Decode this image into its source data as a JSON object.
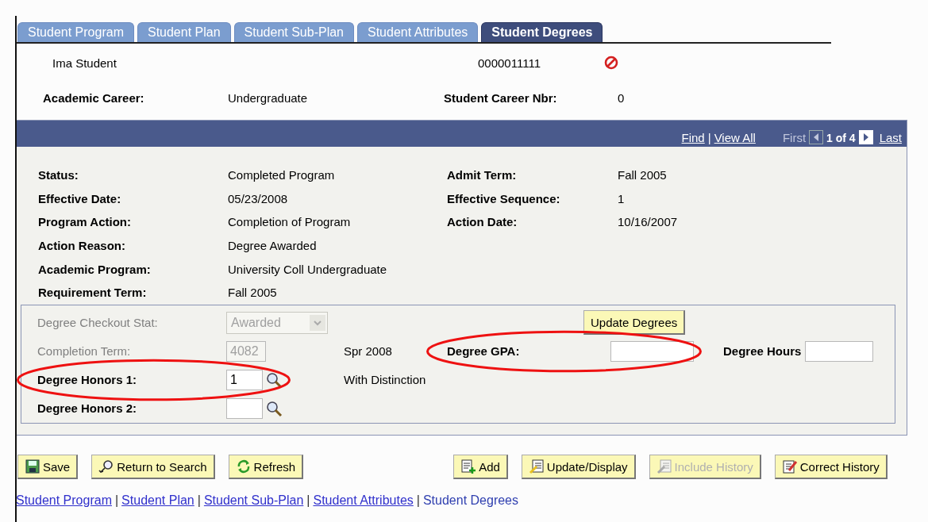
{
  "tabs": [
    {
      "label": "Student Program",
      "selected": false
    },
    {
      "label": "Student Plan",
      "selected": false
    },
    {
      "label": "Student Sub-Plan",
      "selected": false
    },
    {
      "label": "Student Attributes",
      "selected": false
    },
    {
      "label": "Student Degrees",
      "selected": true
    }
  ],
  "header": {
    "name": "Ima Student",
    "id": "0000011111"
  },
  "career": [
    {
      "label": "Academic Career:",
      "value": "Undergraduate"
    },
    {
      "label": "Student Career Nbr:",
      "value": "0"
    }
  ],
  "grid": {
    "nav": [
      {
        "kind": "link",
        "label": "Find"
      },
      {
        "kind": "separator",
        "label": "|"
      },
      {
        "kind": "link",
        "label": "View All"
      },
      {
        "kind": "first",
        "label": "First",
        "disabled": true
      },
      {
        "kind": "prev",
        "disabled": true
      },
      {
        "kind": "position",
        "label": "1 of 4"
      },
      {
        "kind": "next",
        "disabled": false
      },
      {
        "kind": "last",
        "label": "Last",
        "disabled": false
      }
    ],
    "rows": [
      {
        "left": {
          "label": "Status:",
          "value": "Completed Program"
        },
        "right": {
          "label": "Admit Term:",
          "value": "Fall 2005"
        }
      },
      {
        "left": {
          "label": "Effective Date:",
          "value": "05/23/2008"
        },
        "right": {
          "label": "Effective Sequence:",
          "value": "1"
        }
      },
      {
        "left": {
          "label": "Program Action:",
          "value": "Completion of Program"
        },
        "right": {
          "label": "Action Date:",
          "value": "10/16/2007"
        }
      },
      {
        "left": {
          "label": "Action Reason:",
          "value": "Degree Awarded"
        }
      },
      {
        "left": {
          "label": "Academic Program:",
          "value": "University Coll Undergraduate"
        }
      },
      {
        "left": {
          "label": "Requirement Term:",
          "value": "Fall 2005"
        }
      }
    ]
  },
  "degree": {
    "checkout": {
      "label": "Degree Checkout Stat:",
      "value": "Awarded",
      "disabled": true
    },
    "update_button": "Update Degrees",
    "completion": {
      "label": "Completion Term:",
      "value": "4082",
      "description": "Spr 2008",
      "disabled": true
    },
    "gpa": {
      "label": "Degree GPA:",
      "circled": true
    },
    "hours": {
      "label": "Degree Hours"
    },
    "honors": [
      {
        "label": "Degree Honors 1:",
        "value": "1",
        "description": "With Distinction",
        "circled": true
      },
      {
        "label": "Degree Honors 2:",
        "circled": false
      }
    ]
  },
  "buttons": [
    {
      "kind": "save",
      "label": "Save",
      "disabled": false
    },
    {
      "kind": "search",
      "label": "Return to Search",
      "disabled": false
    },
    {
      "kind": "refresh",
      "label": "Refresh",
      "disabled": false
    },
    {
      "kind": "add",
      "label": "Add",
      "disabled": false
    },
    {
      "kind": "update",
      "label": "Update/Display",
      "disabled": false
    },
    {
      "kind": "history",
      "label": "Include History",
      "disabled": true
    },
    {
      "kind": "correct",
      "label": "Correct History",
      "disabled": false
    }
  ],
  "links": [
    {
      "label": "Student Program",
      "selected": false
    },
    {
      "label": "Student Plan",
      "selected": false
    },
    {
      "label": "Student Sub-Plan",
      "selected": false
    },
    {
      "label": "Student Attributes",
      "selected": false
    },
    {
      "label": "Student Degrees",
      "selected": true
    }
  ],
  "link_separator": "|"
}
